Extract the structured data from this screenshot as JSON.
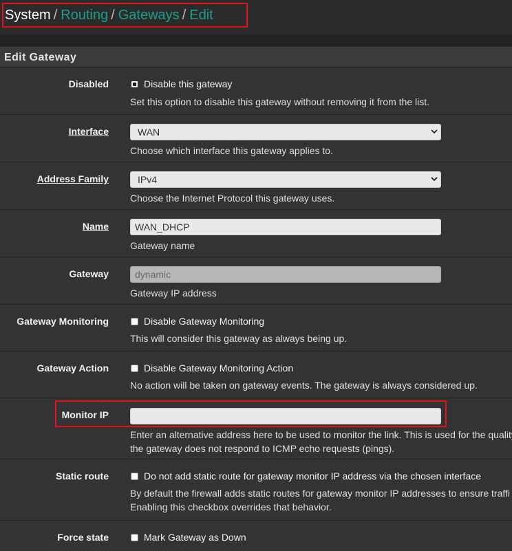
{
  "breadcrumb": {
    "items": [
      "System",
      "Routing",
      "Gateways",
      "Edit"
    ],
    "separator": "/"
  },
  "panel": {
    "title": "Edit Gateway"
  },
  "rows": {
    "disabled": {
      "label": "Disabled",
      "checkbox_label": "Disable this gateway",
      "checked": true,
      "help": "Set this option to disable this gateway without removing it from the list."
    },
    "interface": {
      "label": "Interface",
      "value": "WAN",
      "help": "Choose which interface this gateway applies to."
    },
    "address_family": {
      "label": "Address Family",
      "value": "IPv4",
      "help": "Choose the Internet Protocol this gateway uses."
    },
    "name": {
      "label": "Name",
      "value": "WAN_DHCP",
      "help": "Gateway name"
    },
    "gateway": {
      "label": "Gateway",
      "value": "dynamic",
      "help": "Gateway IP address"
    },
    "gateway_monitoring": {
      "label": "Gateway Monitoring",
      "checkbox_label": "Disable Gateway Monitoring",
      "checked": false,
      "help": "This will consider this gateway as always being up."
    },
    "gateway_action": {
      "label": "Gateway Action",
      "checkbox_label": "Disable Gateway Monitoring Action",
      "checked": false,
      "help": "No action will be taken on gateway events. The gateway is always considered up."
    },
    "monitor_ip": {
      "label": "Monitor IP",
      "value": "",
      "help_line1": "Enter an alternative address here to be used to monitor the link. This is used for the quality",
      "help_line2": "the gateway does not respond to ICMP echo requests (pings)."
    },
    "static_route": {
      "label": "Static route",
      "checkbox_label": "Do not add static route for gateway monitor IP address via the chosen interface",
      "checked": false,
      "help_line1": "By default the firewall adds static routes for gateway monitor IP addresses to ensure traffi",
      "help_line2": "Enabling this checkbox overrides that behavior."
    },
    "force_state": {
      "label": "Force state",
      "checkbox_label": "Mark Gateway as Down",
      "checked": false
    }
  },
  "colors": {
    "accent": "#1aa08a",
    "highlight": "#e0121b",
    "background": "#333333"
  }
}
